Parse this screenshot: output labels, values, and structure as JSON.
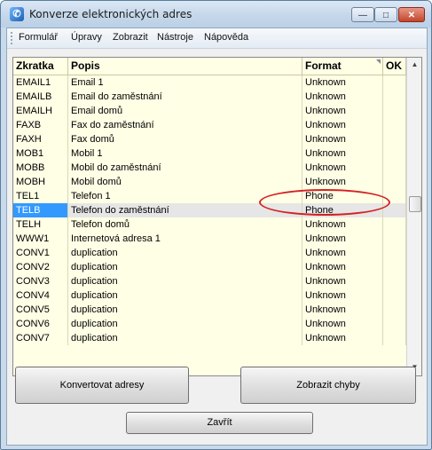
{
  "window": {
    "title": "Konverze elektronických adres",
    "controls": {
      "minimize": "—",
      "maximize": "□",
      "close": "✕"
    }
  },
  "menu": {
    "items": [
      "Formulář",
      "Úpravy",
      "Zobrazit",
      "Nástroje",
      "Nápověda"
    ]
  },
  "grid": {
    "columns": [
      "Zkratka",
      "Popis",
      "Format",
      "OK"
    ],
    "rows": [
      {
        "code": "EMAIL1",
        "desc": "Email 1",
        "format": "Unknown"
      },
      {
        "code": "EMAILB",
        "desc": "Email do zaměstnání",
        "format": "Unknown"
      },
      {
        "code": "EMAILH",
        "desc": "Email domů",
        "format": "Unknown"
      },
      {
        "code": "FAXB",
        "desc": "Fax do zaměstnání",
        "format": "Unknown"
      },
      {
        "code": "FAXH",
        "desc": "Fax domů",
        "format": "Unknown"
      },
      {
        "code": "MOB1",
        "desc": "Mobil 1",
        "format": "Unknown"
      },
      {
        "code": "MOBB",
        "desc": "Mobil do zaměstnání",
        "format": "Unknown"
      },
      {
        "code": "MOBH",
        "desc": "Mobil domů",
        "format": "Unknown"
      },
      {
        "code": "TEL1",
        "desc": "Telefon 1",
        "format": "Phone"
      },
      {
        "code": "TELB",
        "desc": "Telefon do zaměstnání",
        "format": "Phone"
      },
      {
        "code": "TELH",
        "desc": "Telefon domů",
        "format": "Unknown"
      },
      {
        "code": "WWW1",
        "desc": "Internetová adresa 1",
        "format": "Unknown"
      },
      {
        "code": "CONV1",
        "desc": "duplication",
        "format": "Unknown"
      },
      {
        "code": "CONV2",
        "desc": "duplication",
        "format": "Unknown"
      },
      {
        "code": "CONV3",
        "desc": "duplication",
        "format": "Unknown"
      },
      {
        "code": "CONV4",
        "desc": "duplication",
        "format": "Unknown"
      },
      {
        "code": "CONV5",
        "desc": "duplication",
        "format": "Unknown"
      },
      {
        "code": "CONV6",
        "desc": "duplication",
        "format": "Unknown"
      },
      {
        "code": "CONV7",
        "desc": "duplication",
        "format": "Unknown"
      }
    ],
    "selected_code": "TELB"
  },
  "buttons": {
    "convert": "Konvertovat adresy",
    "show_errors": "Zobrazit chyby",
    "close": "Zavřít"
  },
  "colors": {
    "grid_background": "#ffffe6",
    "selection": "#3399ff",
    "annotation": "#d42222"
  }
}
